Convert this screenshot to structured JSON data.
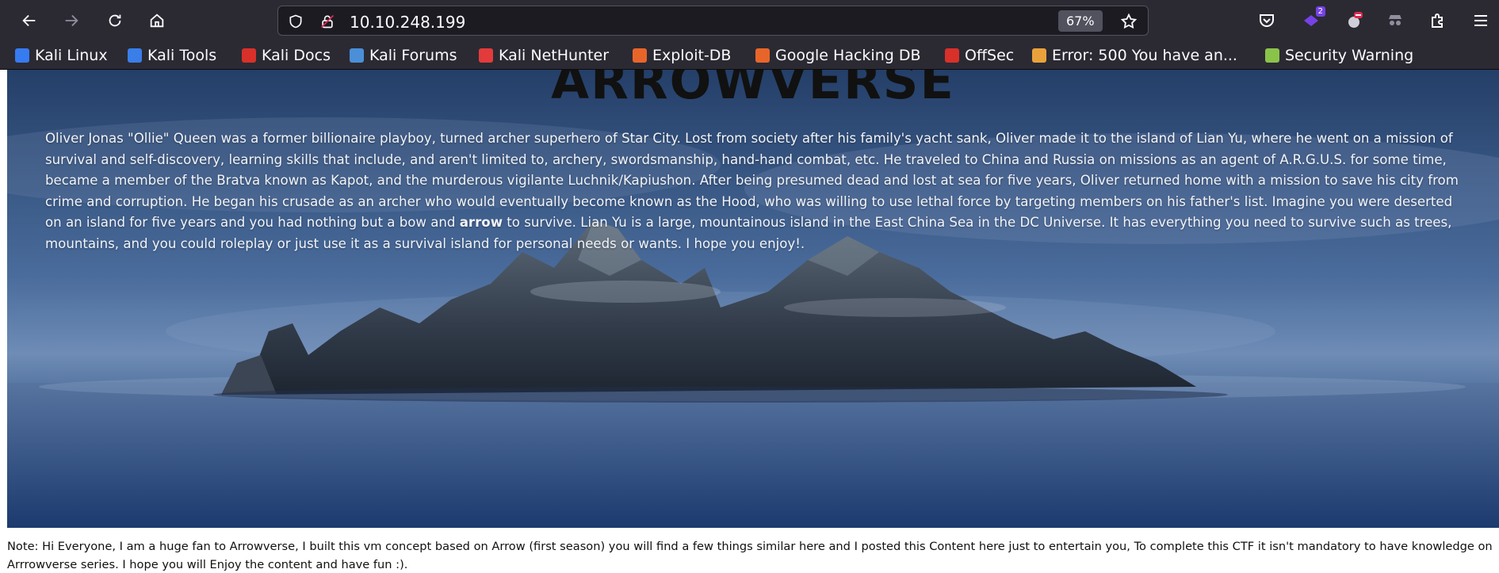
{
  "browser": {
    "url": "10.10.248.199",
    "zoom": "67%",
    "extension_badge": "2"
  },
  "bookmarks": [
    {
      "label": "Kali Linux",
      "color": "#367bf0"
    },
    {
      "label": "Kali Tools",
      "color": "#3a7ee8"
    },
    {
      "label": "Kali Docs",
      "color": "#d9302a"
    },
    {
      "label": "Kali Forums",
      "color": "#4a8fd8"
    },
    {
      "label": "Kali NetHunter",
      "color": "#e33b3b"
    },
    {
      "label": "Exploit-DB",
      "color": "#e8652a"
    },
    {
      "label": "Google Hacking DB",
      "color": "#e8652a"
    },
    {
      "label": "OffSec",
      "color": "#d9302a"
    },
    {
      "label": "Error: 500 You have an...",
      "color": "#e9a23b"
    },
    {
      "label": "Security Warning",
      "color": "#8ac34a"
    }
  ],
  "page": {
    "title": "ARROWVERSE",
    "paragraph_before": "Oliver Jonas \"Ollie\" Queen was a former billionaire playboy, turned archer superhero of Star City. Lost from society after his family's yacht sank, Oliver made it to the island of Lian Yu, where he went on a mission of survival and self-discovery, learning skills that include, and aren't limited to, archery, swordsmanship, hand-hand combat, etc. He traveled to China and Russia on missions as an agent of A.R.G.U.S. for some time, became a member of the Bratva known as Kapot, and the murderous vigilante Luchnik/Kapiushon. After being presumed dead and lost at sea for five years, Oliver returned home with a mission to save his city from crime and corruption. He began his crusade as an archer who would eventually become known as the Hood, who was willing to use lethal force by targeting members on his father's list. Imagine you were deserted on an island for five years and you had nothing but a bow and ",
    "paragraph_bold": "arrow",
    "paragraph_after": " to survive. Lian Yu is a large, mountainous island in the East China Sea in the DC Universe. It has everything you need to survive such as trees, mountains, and you could roleplay or just use it as a survival island for personal needs or wants. I hope you enjoy!.",
    "note": "Note: Hi Everyone, I am a huge fan to Arrowverse, I built this vm concept based on Arrow (first season) you will find a few things similar here and I posted this Content here just to entertain you, To complete this CTF it isn't mandatory to have knowledge on Arrrowverse series. I hope you will Enjoy the content and have fun :)."
  }
}
